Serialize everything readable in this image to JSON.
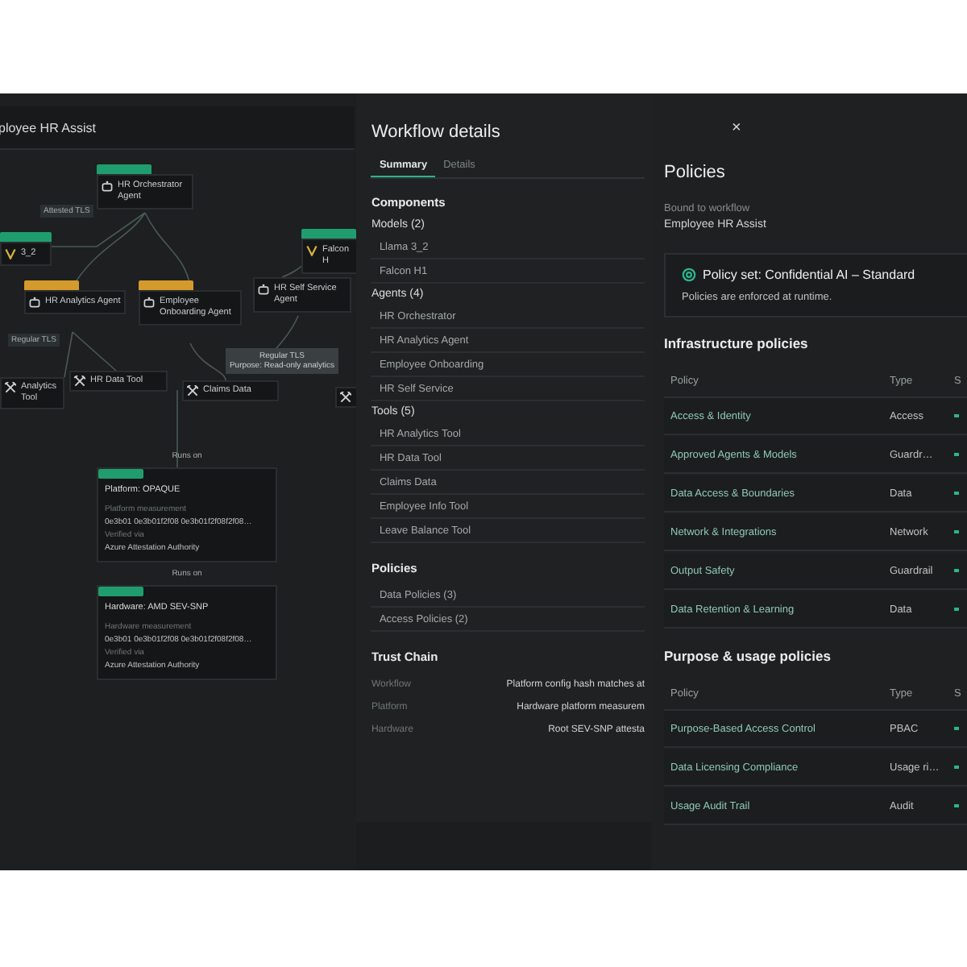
{
  "diagram": {
    "title": "ployee HR Assist",
    "nodes": [
      {
        "kind": "agent",
        "label": "HR Orchestrator Agent",
        "color": "#1f9d6e"
      },
      {
        "kind": "model",
        "label": "3_2",
        "color": "#1f9d6e"
      },
      {
        "kind": "model",
        "label": "Falcon H",
        "color": "#1f9d6e"
      },
      {
        "kind": "agent",
        "label": "HR Analytics Agent",
        "color": "#d59a2c"
      },
      {
        "kind": "agent",
        "label": "Employee Onboarding Agent",
        "color": "#d59a2c"
      },
      {
        "kind": "agent",
        "label": "HR Self Service Agent"
      },
      {
        "kind": "tool",
        "label": "Analytics Tool"
      },
      {
        "kind": "tool",
        "label": "HR Data Tool"
      },
      {
        "kind": "tool",
        "label": "Claims Data"
      },
      {
        "kind": "tool"
      }
    ],
    "edge_labels": [
      "Attested TLS",
      "Regular TLS"
    ],
    "tooltip": [
      "Regular TLS",
      "Purpose: Read-only analytics"
    ],
    "chain": [
      {
        "connector": "Runs on",
        "title": "Platform: OPAQUE",
        "measurement_label": "Platform measurement",
        "measurement": "0e3b01 0e3b01f2f08 0e3b01f2f08f2f08…",
        "verified_label": "Verified via",
        "verified": "Azure Attestation Authority",
        "color": "#1f9d6e"
      },
      {
        "connector": "Runs on",
        "title": "Hardware: AMD SEV-SNP",
        "measurement_label": "Hardware measurement",
        "measurement": "0e3b01 0e3b01f2f08 0e3b01f2f08f2f08…",
        "verified_label": "Verified via",
        "verified": "Azure Attestation Authority",
        "color": "#1f9d6e"
      }
    ]
  },
  "details": {
    "title": "Workflow details",
    "tabs": [
      {
        "label": "Summary",
        "selected": true
      },
      {
        "label": "Details",
        "selected": false
      }
    ],
    "components_title": "Components",
    "groups": [
      {
        "title": "Models (2)",
        "items": [
          "Llama 3_2",
          "Falcon H1"
        ]
      },
      {
        "title": "Agents (4)",
        "items": [
          "HR Orchestrator",
          "HR Analytics Agent",
          "Employee Onboarding",
          "HR Self Service"
        ]
      },
      {
        "title": "Tools (5)",
        "items": [
          "HR Analytics Tool",
          "HR Data Tool",
          "Claims Data",
          "Employee Info Tool",
          "Leave Balance Tool"
        ]
      }
    ],
    "policies": {
      "title": "Policies",
      "items": [
        "Data Policies (3)",
        "Access Policies (2)"
      ]
    },
    "trust_chain": {
      "title": "Trust Chain",
      "rows": [
        {
          "label": "Workflow",
          "value": "Platform config hash matches at"
        },
        {
          "label": "Platform",
          "value": "Hardware platform measurem"
        },
        {
          "label": "Hardware",
          "value": "Root SEV-SNP attesta"
        }
      ]
    }
  },
  "policies": {
    "close": "×",
    "title": "Policies",
    "bound_label": "Bound to workflow",
    "bound_value": "Employee HR Assist",
    "policy_set": {
      "title": "Policy set: Confidential AI – Standard",
      "note": "Policies are enforced at runtime."
    },
    "tables": [
      {
        "title": "Infrastructure policies",
        "columns": [
          "Policy",
          "Type",
          "S"
        ],
        "rows": [
          {
            "policy": "Access & Identity",
            "type": "Access",
            "enforced": true
          },
          {
            "policy": "Approved Agents & Models",
            "type": "Guardr…",
            "enforced": true
          },
          {
            "policy": "Data Access & Boundaries",
            "type": "Data",
            "enforced": true
          },
          {
            "policy": "Network & Integrations",
            "type": "Network",
            "enforced": true
          },
          {
            "policy": "Output Safety",
            "type": "Guardrail",
            "enforced": true
          },
          {
            "policy": "Data Retention & Learning",
            "type": "Data",
            "enforced": true
          }
        ]
      },
      {
        "title": "Purpose & usage policies",
        "columns": [
          "Policy",
          "Type",
          "S"
        ],
        "rows": [
          {
            "policy": "Purpose-Based Access Control",
            "type": "PBAC",
            "enforced": true
          },
          {
            "policy": "Data Licensing Compliance",
            "type": "Usage ri…",
            "enforced": true
          },
          {
            "policy": "Usage Audit Trail",
            "type": "Audit",
            "enforced": true
          }
        ]
      }
    ]
  }
}
